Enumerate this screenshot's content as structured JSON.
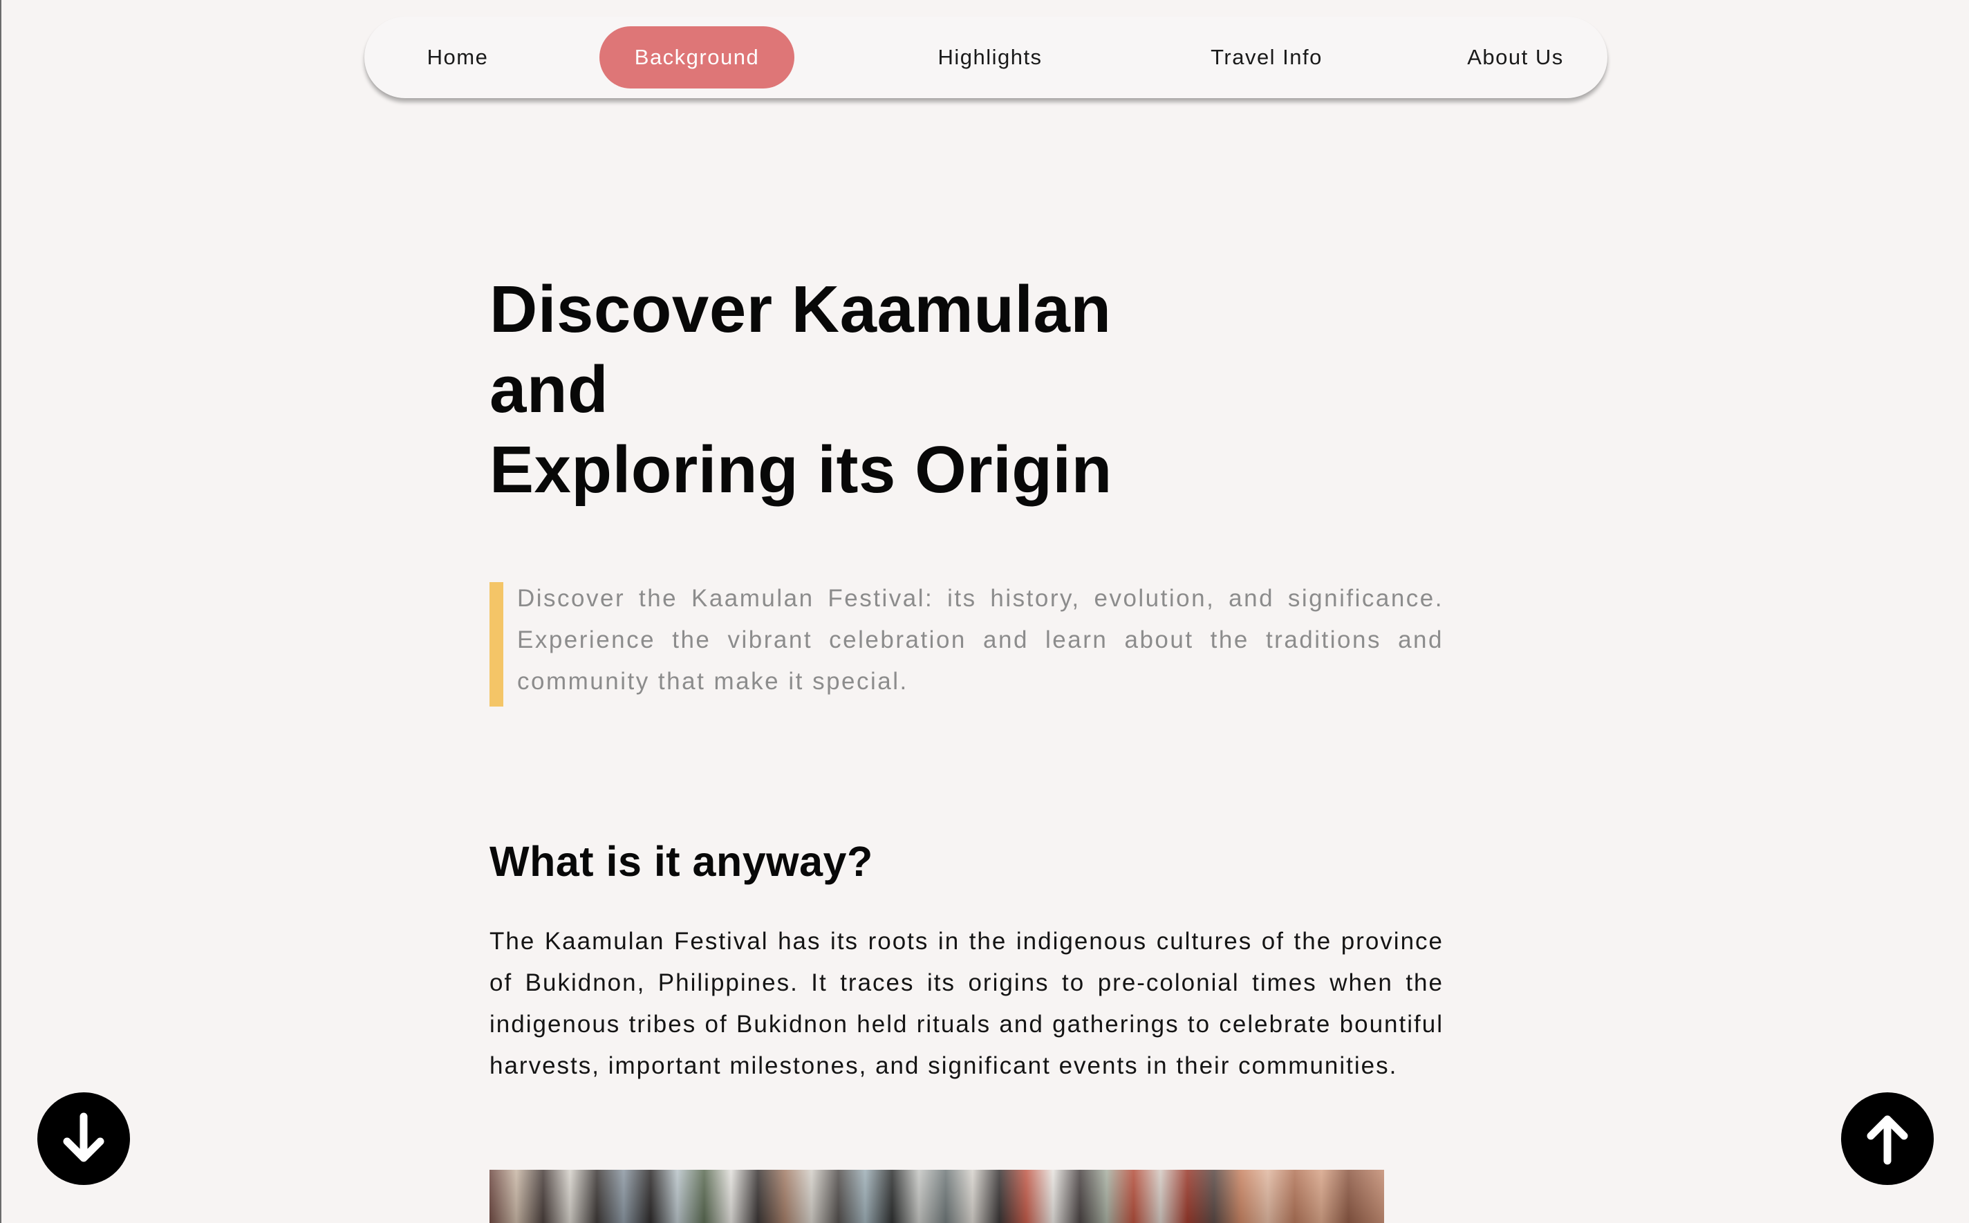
{
  "nav": {
    "items": [
      {
        "label": "Home",
        "active": false
      },
      {
        "label": "Background",
        "active": true
      },
      {
        "label": "Highlights",
        "active": false
      },
      {
        "label": "Travel Info",
        "active": false
      },
      {
        "label": "About Us",
        "active": false
      }
    ],
    "active_color": "#de7677"
  },
  "hero": {
    "title_lines": [
      "Discover Kaamulan",
      "and",
      "Exploring its Origin"
    ],
    "lead": "Discover the Kaamulan Festival: its history, evolution, and significance. Experience the vibrant celebration and learn about the traditions and community that make it special.",
    "lead_bar_color": "#f4c567"
  },
  "section": {
    "heading": "What is it anyway?",
    "body": "The Kaamulan Festival has its roots in the indigenous cultures of the province of Bukidnon, Philippines. It traces its origins to pre-colonial times when the indigenous tribes of Bukidnon held rituals and gatherings to celebrate bountiful harvests, important milestones, and significant events in their communities."
  },
  "controls": {
    "scroll_down_icon": "arrow-down-circle-icon",
    "scroll_up_icon": "arrow-up-circle-icon"
  }
}
